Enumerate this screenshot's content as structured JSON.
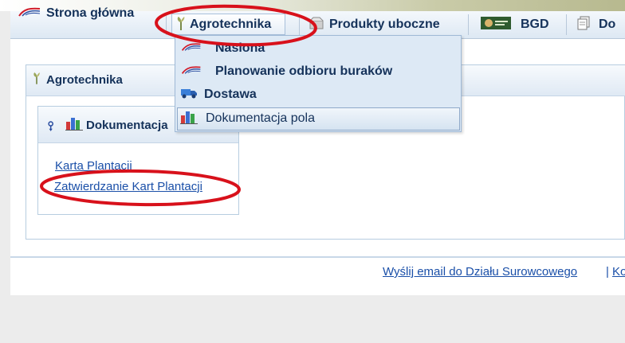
{
  "nav": {
    "home_label": "Strona główna",
    "agro_label": "Agrotechnika",
    "byproducts_label": "Produkty uboczne",
    "bgd_label": "BGD",
    "doc_label": "Do"
  },
  "dropdown": {
    "items": [
      {
        "label": "Nasiona"
      },
      {
        "label": "Planowanie odbioru buraków"
      },
      {
        "label": "Dostawa"
      },
      {
        "label": "Dokumentacja pola"
      }
    ]
  },
  "panel": {
    "title": "Agrotechnika"
  },
  "box": {
    "title": "Dokumentacja",
    "links": [
      {
        "label": "Karta Plantacji"
      },
      {
        "label": "Zatwierdzanie Kart Plantacji"
      }
    ]
  },
  "footer": {
    "email_link": "Wyślij email do Działu Surowcowego",
    "separator": "|",
    "next_link": "Ko"
  },
  "colors": {
    "annotation": "#d8111b",
    "nav_text": "#15325a",
    "link": "#1a4fa8"
  }
}
